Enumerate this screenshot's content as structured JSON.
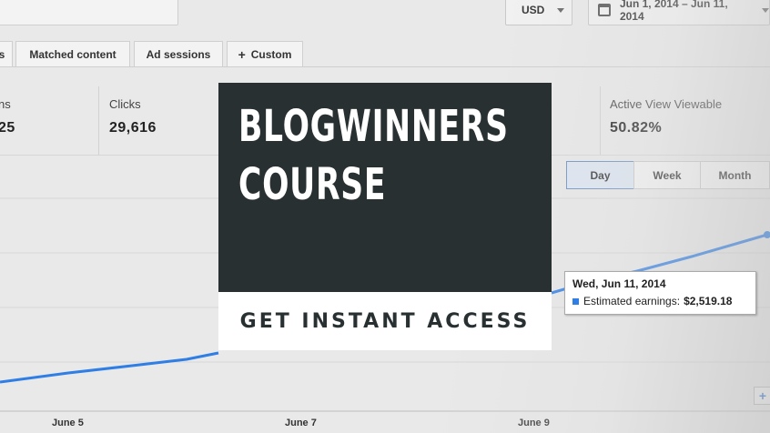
{
  "toolbar": {
    "currency": "USD",
    "date_range": "Jun 1, 2014 – Jun 11, 2014"
  },
  "tabs": [
    {
      "label": "s"
    },
    {
      "label": "Matched content"
    },
    {
      "label": "Ad sessions"
    },
    {
      "label": "Custom"
    }
  ],
  "stats": [
    {
      "label": "ns",
      "value": "25"
    },
    {
      "label": "Clicks",
      "value": "29,616"
    },
    {
      "label": "Active View Viewable",
      "value": "50.82%"
    }
  ],
  "periods": [
    {
      "label": "Day",
      "active": true
    },
    {
      "label": "Week",
      "active": false
    },
    {
      "label": "Month",
      "active": false
    }
  ],
  "chart_data": {
    "type": "line",
    "x_labels": [
      "June 5",
      "June 7",
      "June 9"
    ],
    "series_color": "#2f7ee6",
    "tooltip": {
      "date": "Wed, Jun 11, 2014",
      "label": "Estimated earnings:",
      "value": "$2,519.18"
    }
  },
  "banner": {
    "title_line1": "BLOGWINNERS",
    "title_line2": "COURSE",
    "cta": "GET INSTANT ACCESS"
  },
  "icons": {
    "calendar": "calendar-icon",
    "zoom": "+"
  }
}
